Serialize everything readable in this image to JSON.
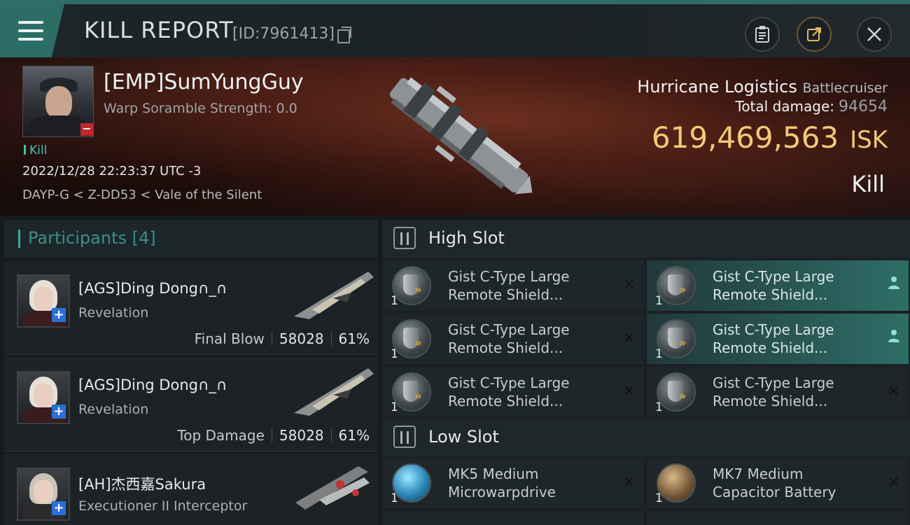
{
  "header": {
    "title": "KILL REPORT",
    "report_id": "[ID:7961413]",
    "menu_icon": "hamburger-menu-icon",
    "buttons": [
      "clipboard-icon",
      "share-icon",
      "close-icon"
    ]
  },
  "victim": {
    "name": "[EMP]SumYungGuy",
    "warp_scramble": "Warp Soramble Strength: 0.0",
    "tag": "Kill",
    "time": "2022/12/28 22:23:37 UTC -3",
    "location": "DAYP-G < Z-DD53 < Vale of the Silent",
    "ship_name": "Hurricane Logistics",
    "ship_class": "Battlecruiser",
    "total_damage_label": "Total damage:",
    "total_damage": "94654",
    "isk_value": "619,469,563",
    "isk_unit": "ISK",
    "result": "Kill"
  },
  "participants": {
    "title": "Participants",
    "count": "[4]",
    "items": [
      {
        "name": "[AGS]Ding Dong∩_∩",
        "ship": "Revelation",
        "tag": "Final Blow",
        "damage": "58028",
        "percent": "61%"
      },
      {
        "name": "[AGS]Ding Dong∩_∩",
        "ship": "Revelation",
        "tag": "Top Damage",
        "damage": "58028",
        "percent": "61%"
      },
      {
        "name": "[AH]杰西嘉Sakura",
        "ship": "Executioner II Interceptor"
      }
    ]
  },
  "fitting": {
    "high_slot_label": "High Slot",
    "low_slot_label": "Low Slot",
    "high_slots": [
      {
        "qty": "1",
        "line1": "Gist C-Type Large",
        "line2": "Remote Shield...",
        "status": "×"
      },
      {
        "qty": "1",
        "line1": "Gist C-Type Large",
        "line2": "Remote Shield...",
        "status": "person"
      },
      {
        "qty": "1",
        "line1": "Gist C-Type Large",
        "line2": "Remote Shield...",
        "status": "×"
      },
      {
        "qty": "1",
        "line1": "Gist C-Type Large",
        "line2": "Remote Shield...",
        "status": "person"
      },
      {
        "qty": "1",
        "line1": "Gist C-Type Large",
        "line2": "Remote Shield...",
        "status": "×"
      },
      {
        "qty": "1",
        "line1": "Gist C-Type Large",
        "line2": "Remote Shield...",
        "status": "×"
      }
    ],
    "low_slots": [
      {
        "qty": "1",
        "line1": "MK5 Medium",
        "line2": "Microwarpdrive",
        "status": "×"
      },
      {
        "qty": "1",
        "line1": "MK7 Medium",
        "line2": "Capacitor Battery",
        "status": "×"
      }
    ]
  },
  "colors": {
    "accent_teal": "#2c6d66",
    "isk_gold": "#f3c978",
    "highlight_teal": "#2e6e67"
  }
}
